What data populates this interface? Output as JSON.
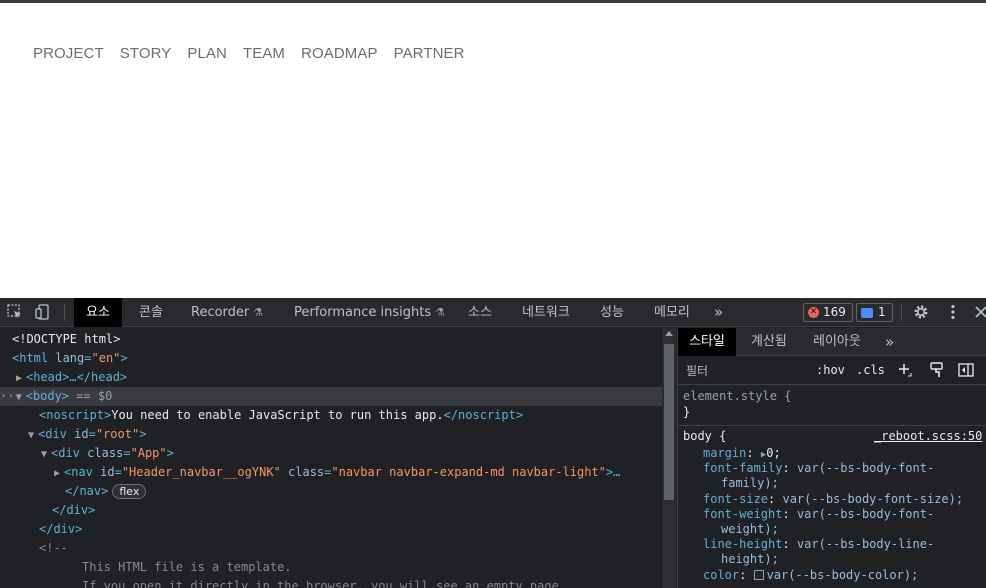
{
  "site": {
    "nav": [
      "PROJECT",
      "STORY",
      "PLAN",
      "TEAM",
      "ROADMAP",
      "PARTNER"
    ]
  },
  "devtools": {
    "tabs": {
      "elements": "요소",
      "console": "콘솔",
      "recorder": "Recorder",
      "perf_insights": "Performance insights",
      "sources": "소스",
      "network": "네트워크",
      "performance": "성능",
      "memory": "메모리",
      "more": "»"
    },
    "error_count": "169",
    "message_count": "1",
    "dom": {
      "doctype": "<!DOCTYPE html>",
      "html_open": "<html",
      "html_attr": "lang",
      "html_lang": "\"en\"",
      "head": "<head>…</head>",
      "body_tag": "<body>",
      "body_eq": "== $0",
      "noscript_open": "<noscript>",
      "noscript_text": "You need to enable JavaScript to run this app.",
      "noscript_close": "</noscript>",
      "root_tag": "<div",
      "root_attr": "id",
      "root_val": "\"root\"",
      "app_attr": "class",
      "app_val": "\"App\"",
      "nav_tag": "<nav",
      "nav_id_attr": "id",
      "nav_id_val": "\"Header_navbar__ogYNK\"",
      "nav_class_attr": "class",
      "nav_class_val": "\"navbar navbar-expand-md navbar-light\"",
      "nav_ellipsis": ">…",
      "nav_close": "</nav>",
      "flex_badge": "flex",
      "div_close": "</div>",
      "comment_open": "<!--",
      "comment_1": "This HTML file is a template.",
      "comment_2": "If you open it directly in the browser, you will see an empty page."
    },
    "styles": {
      "tabs": [
        "스타일",
        "계산됨",
        "레이아웃",
        "»"
      ],
      "filter_placeholder": "필터",
      "hov": ":hov",
      "cls": ".cls",
      "element_style": "element.style {",
      "close_brace": "}",
      "body_selector": "body {",
      "body_source": "_reboot.scss:50",
      "decls": [
        {
          "prop": "margin",
          "val": "0;"
        },
        {
          "prop": "font-family",
          "val": "var(--bs-body-font-",
          "cont": "family);"
        },
        {
          "prop": "font-size",
          "val": "var(--bs-body-font-size);"
        },
        {
          "prop": "font-weight",
          "val": "var(--bs-body-font-",
          "cont": "weight);"
        },
        {
          "prop": "line-height",
          "val": "var(--bs-body-line-",
          "cont": "height);"
        },
        {
          "prop": "color",
          "val": "var(--bs-body-color);"
        }
      ]
    }
  }
}
